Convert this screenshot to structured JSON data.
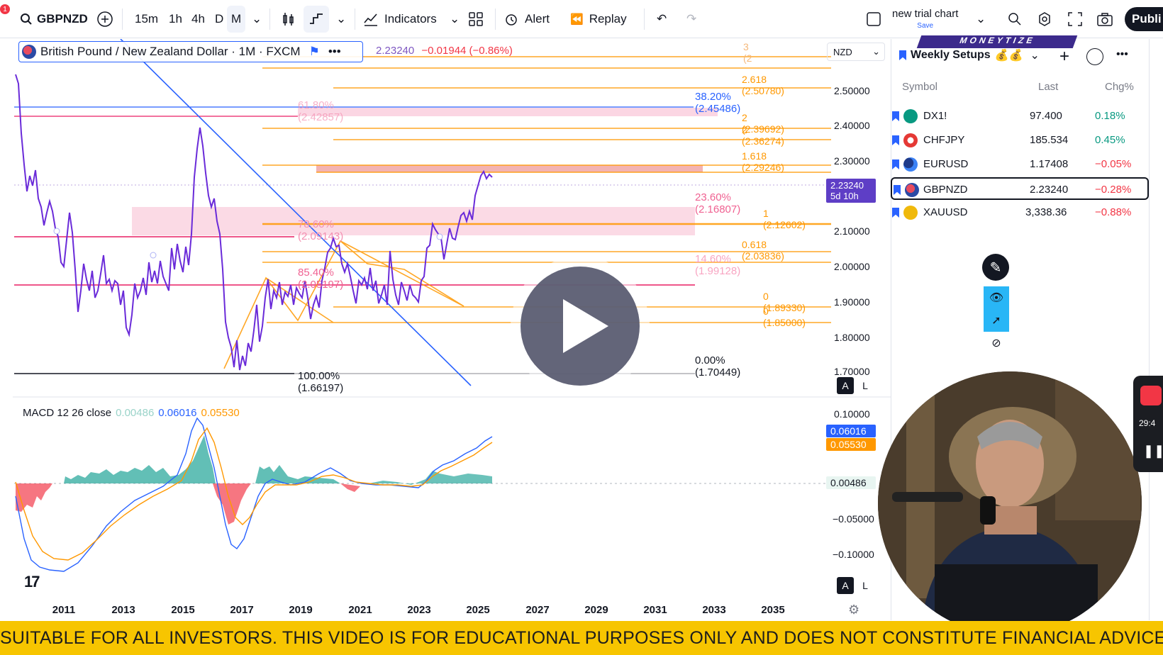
{
  "toolbar": {
    "notif_count": "1",
    "symbol": "GBPNZD",
    "intervals": [
      "15m",
      "1h",
      "4h",
      "D",
      "M"
    ],
    "indicators_label": "Indicators",
    "alert_label": "Alert",
    "replay_label": "Replay",
    "layout_name": "new trial chart",
    "save_label": "Save",
    "publish_label": "Publi"
  },
  "legend": {
    "title": "British Pound / New Zealand Dollar · 1M · FXCM",
    "price": "2.23240",
    "change": "−0.01944 (−0.86%)"
  },
  "currency_select": "NZD",
  "price_scale": [
    "2.50000",
    "2.40000",
    "2.30000",
    "2.10000",
    "2.00000",
    "1.90000",
    "1.80000",
    "1.70000"
  ],
  "current_price_tag": {
    "price": "2.23240",
    "countdown": "5d 10h"
  },
  "macd": {
    "label": "MACD 12 26 close",
    "hist": "0.00486",
    "macd": "0.06016",
    "signal": "0.05530",
    "scale": [
      "0.10000",
      "−0.05000",
      "−0.10000"
    ]
  },
  "fib_labels": {
    "f3": "3 (2",
    "f2618": "2.618 (2.50780)",
    "f2": "2 (2.39692)",
    "f2b": "2 (2.36274)",
    "f1618": "1.618 (2.29246)",
    "f1": "1 (2.12602)",
    "f0618": "0.618 (2.03836)",
    "f0a": "0 (1.89330)",
    "f0b": "0 (1.85000)",
    "r382": "38.20% (2.45486)",
    "r236": "23.60% (2.16807)",
    "r146": "14.60% (1.99128)",
    "r0": "0.00% (1.70449)",
    "r618": "61.80% (2.42857)",
    "r786": "78.60% (2.09143)",
    "r854": "85.40% (2.05197)",
    "r100": "100.00% (1.66197)"
  },
  "time_axis": [
    "2011",
    "2013",
    "2015",
    "2017",
    "2019",
    "2021",
    "2023",
    "2025",
    "2027",
    "2029",
    "2031",
    "2033",
    "2035"
  ],
  "scale_buttons": {
    "auto": "A",
    "log": "L"
  },
  "watchlist": {
    "title": "Weekly Setups",
    "columns": {
      "symbol": "Symbol",
      "last": "Last",
      "chg": "Chg%"
    },
    "rows": [
      {
        "symbol": "DX1!",
        "last": "97.400",
        "chg": "0.18%",
        "dir": "pos"
      },
      {
        "symbol": "CHFJPY",
        "last": "185.534",
        "chg": "0.45%",
        "dir": "pos"
      },
      {
        "symbol": "EURUSD",
        "last": "1.17408",
        "chg": "−0.05%",
        "dir": "neg"
      },
      {
        "symbol": "GBPNZD",
        "last": "2.23240",
        "chg": "−0.28%",
        "dir": "neg"
      },
      {
        "symbol": "XAUUSD",
        "last": "3,338.36",
        "chg": "−0.88%",
        "dir": "neg"
      }
    ]
  },
  "watermark": "MONEYTIZE",
  "recorder_time": "29:4",
  "disclaimer": "SUITABLE FOR ALL INVESTORS. THIS VIDEO IS FOR EDUCATIONAL PURPOSES ONLY AND DOES NOT CONSTITUTE FINANCIAL ADVICE.",
  "colors": {
    "accent": "#2962ff",
    "price_line": "#7e57c2",
    "fib": "#ff9800",
    "banner": "#f7c500"
  }
}
